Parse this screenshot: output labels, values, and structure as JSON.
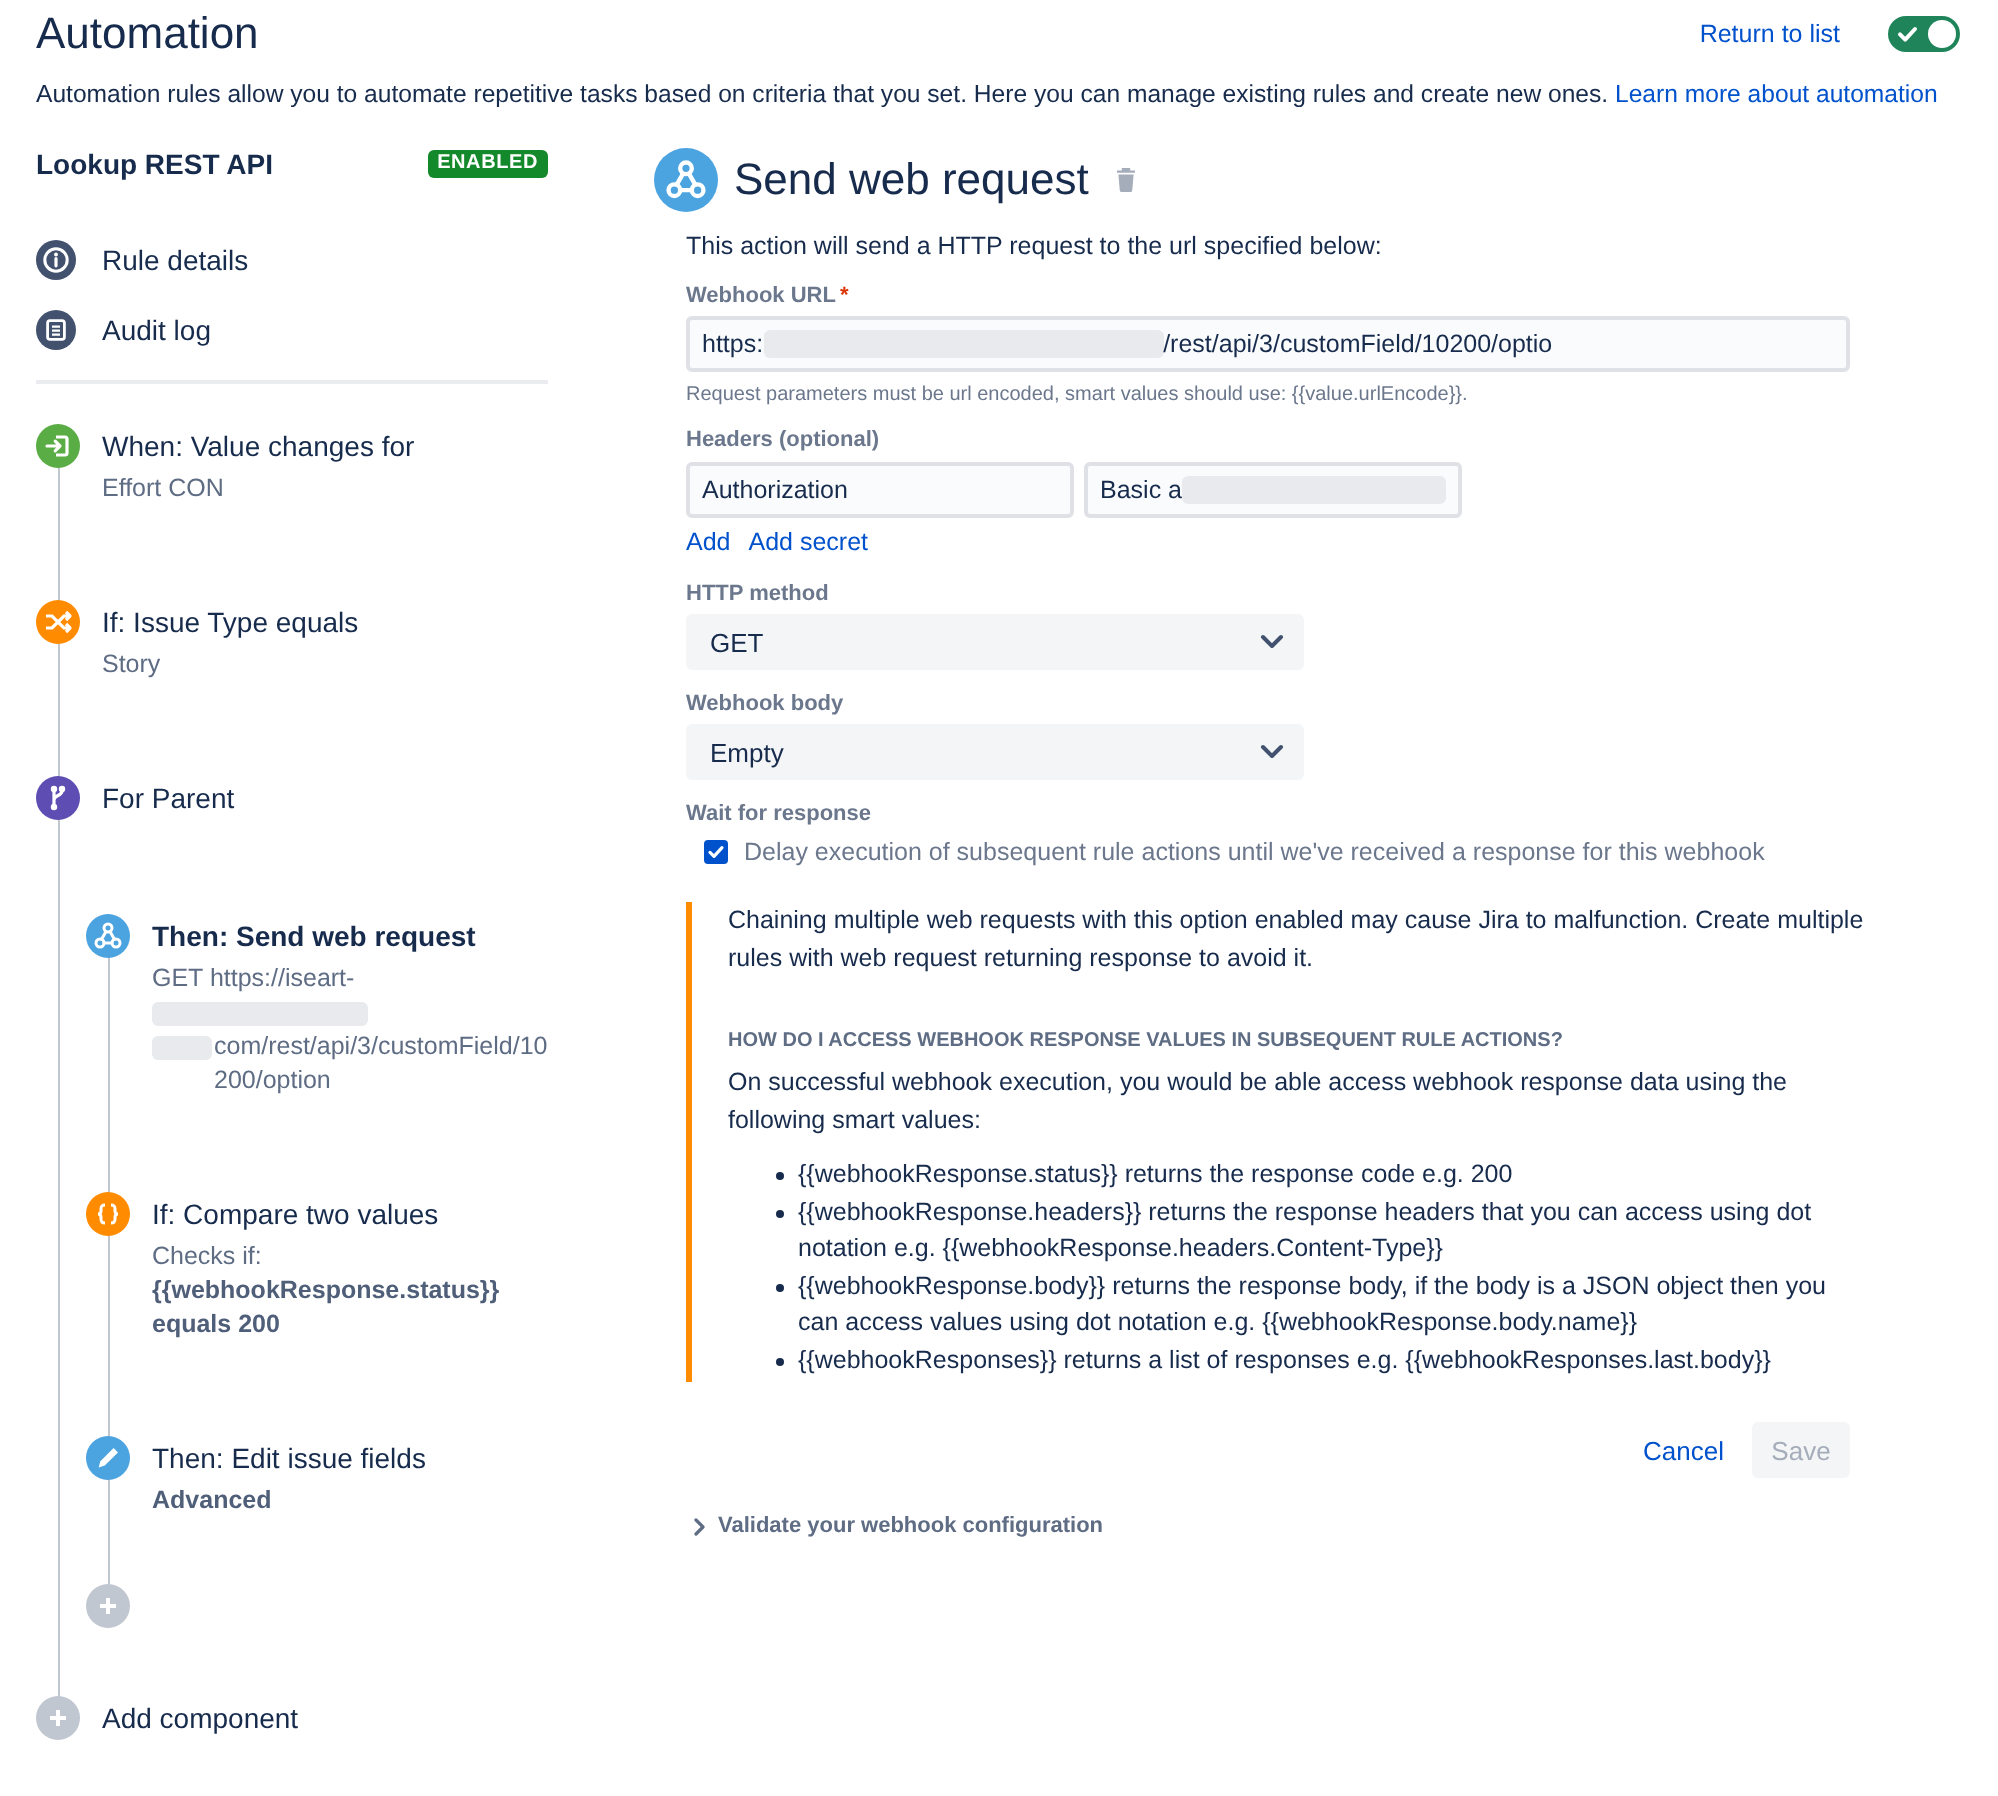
{
  "header": {
    "title": "Automation",
    "return_link": "Return to list",
    "rule_toggle": {
      "on": true
    },
    "description": "Automation rules allow you to automate repetitive tasks based on criteria that you set. Here you can manage existing rules and create new ones.",
    "learn_more_link": "Learn more about automation"
  },
  "sidebar": {
    "rule_name": "Lookup REST API",
    "status_badge": "ENABLED",
    "nav_items": [
      {
        "kind": "details",
        "label": "Rule details"
      },
      {
        "kind": "audit",
        "label": "Audit log"
      }
    ],
    "components": [
      {
        "kind": "trigger",
        "title": "When: Value changes for",
        "selected": false,
        "details": [
          {
            "parts": [
              {
                "kind": "text",
                "text": "Effort CON"
              }
            ]
          }
        ]
      },
      {
        "kind": "condition",
        "title": "If: Issue Type equals",
        "selected": false,
        "details": [
          {
            "parts": [
              {
                "kind": "text",
                "text": "Story"
              }
            ]
          }
        ]
      },
      {
        "kind": "branch",
        "title": "For Parent",
        "selected": false,
        "children": [
          {
            "kind": "webhook",
            "title": "Then: Send web request",
            "selected": true,
            "details": [
              {
                "parts": [
                  {
                    "kind": "text",
                    "text": "GET https://iseart-"
                  }
                ]
              },
              {
                "parts": [
                  {
                    "kind": "redacted"
                  }
                ]
              },
              {
                "parts": [
                  {
                    "kind": "redacted"
                  },
                  {
                    "kind": "text",
                    "text": "com/rest/api/3/customField/10200/option"
                  }
                ]
              }
            ]
          },
          {
            "kind": "compare",
            "title": "If: Compare two values",
            "selected": false,
            "details": [
              {
                "parts": [
                  {
                    "kind": "text",
                    "text": "Checks if:"
                  }
                ]
              },
              {
                "parts": [
                  {
                    "kind": "strong",
                    "text": "{{webhookResponse.status}} equals 200"
                  }
                ]
              }
            ]
          },
          {
            "kind": "edit",
            "title": "Then: Edit issue fields",
            "selected": false,
            "details": [
              {
                "parts": [
                  {
                    "kind": "strong",
                    "text": "Advanced"
                  }
                ]
              }
            ]
          }
        ]
      }
    ],
    "add_component": "Add component"
  },
  "action_panel": {
    "title": "Send web request",
    "intro": "This action will send a HTTP request to the url specified below:",
    "webhook_url": {
      "label": "Webhook URL",
      "required_mark": "*",
      "value_parts": [
        {
          "kind": "text",
          "text": "https:"
        },
        {
          "kind": "redacted"
        },
        {
          "kind": "text",
          "text": "/rest/api/3/customField/10200/optio"
        }
      ]
    },
    "url_hint": "Request parameters must be url encoded, smart values should use: {{value.urlEncode}}.",
    "headers": {
      "label": "Headers (optional)",
      "rows": [
        {
          "name": "Authorization",
          "value_parts": [
            {
              "kind": "text",
              "text": "Basic a"
            },
            {
              "kind": "redacted"
            }
          ]
        }
      ],
      "links": [
        "Add",
        "Add secret"
      ]
    },
    "http_method": {
      "label": "HTTP method",
      "value": "GET"
    },
    "webhook_body": {
      "label": "Webhook body",
      "value": "Empty"
    },
    "wait_for_response": {
      "label": "Wait for response",
      "option": "Delay execution of subsequent rule actions until we've received a response for this webhook",
      "checked": true
    },
    "info_panel": {
      "warning": "Chaining multiple web requests with this option enabled may cause Jira to malfunction. Create multiple rules with web request returning response to avoid it.",
      "heading": "HOW DO I ACCESS WEBHOOK RESPONSE VALUES IN SUBSEQUENT RULE ACTIONS?",
      "intro": "On successful webhook execution, you would be able access webhook response data using the following smart values:",
      "items": [
        "{{webhookResponse.status}} returns the response code e.g. 200",
        "{{webhookResponse.headers}} returns the response headers that you can access using dot notation e.g. {{webhookResponse.headers.Content-Type}}",
        "{{webhookResponse.body}} returns the response body, if the body is a JSON object then you can access values using dot notation e.g. {{webhookResponse.body.name}}",
        "{{webhookResponses}} returns a list of responses e.g. {{webhookResponses.last.body}}"
      ]
    },
    "cancel_button": "Cancel",
    "save_button": {
      "label": "Save",
      "disabled": true
    },
    "validate": {
      "label": "Validate your webhook configuration",
      "expanded": false
    }
  }
}
